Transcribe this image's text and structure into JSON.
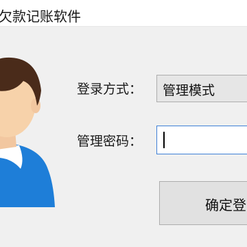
{
  "window": {
    "title": "欠款记账软件"
  },
  "form": {
    "login_mode_label": "登录方式：",
    "login_mode_value": "管理模式",
    "password_label": "管理密码：",
    "password_value": "",
    "confirm_label": "确定登"
  },
  "colors": {
    "skin": "#f7d2aa",
    "hair": "#4a2b1a",
    "shirt": "#1e7ed8",
    "collar": "#ffffff",
    "focus_border": "#3e7fd6"
  }
}
